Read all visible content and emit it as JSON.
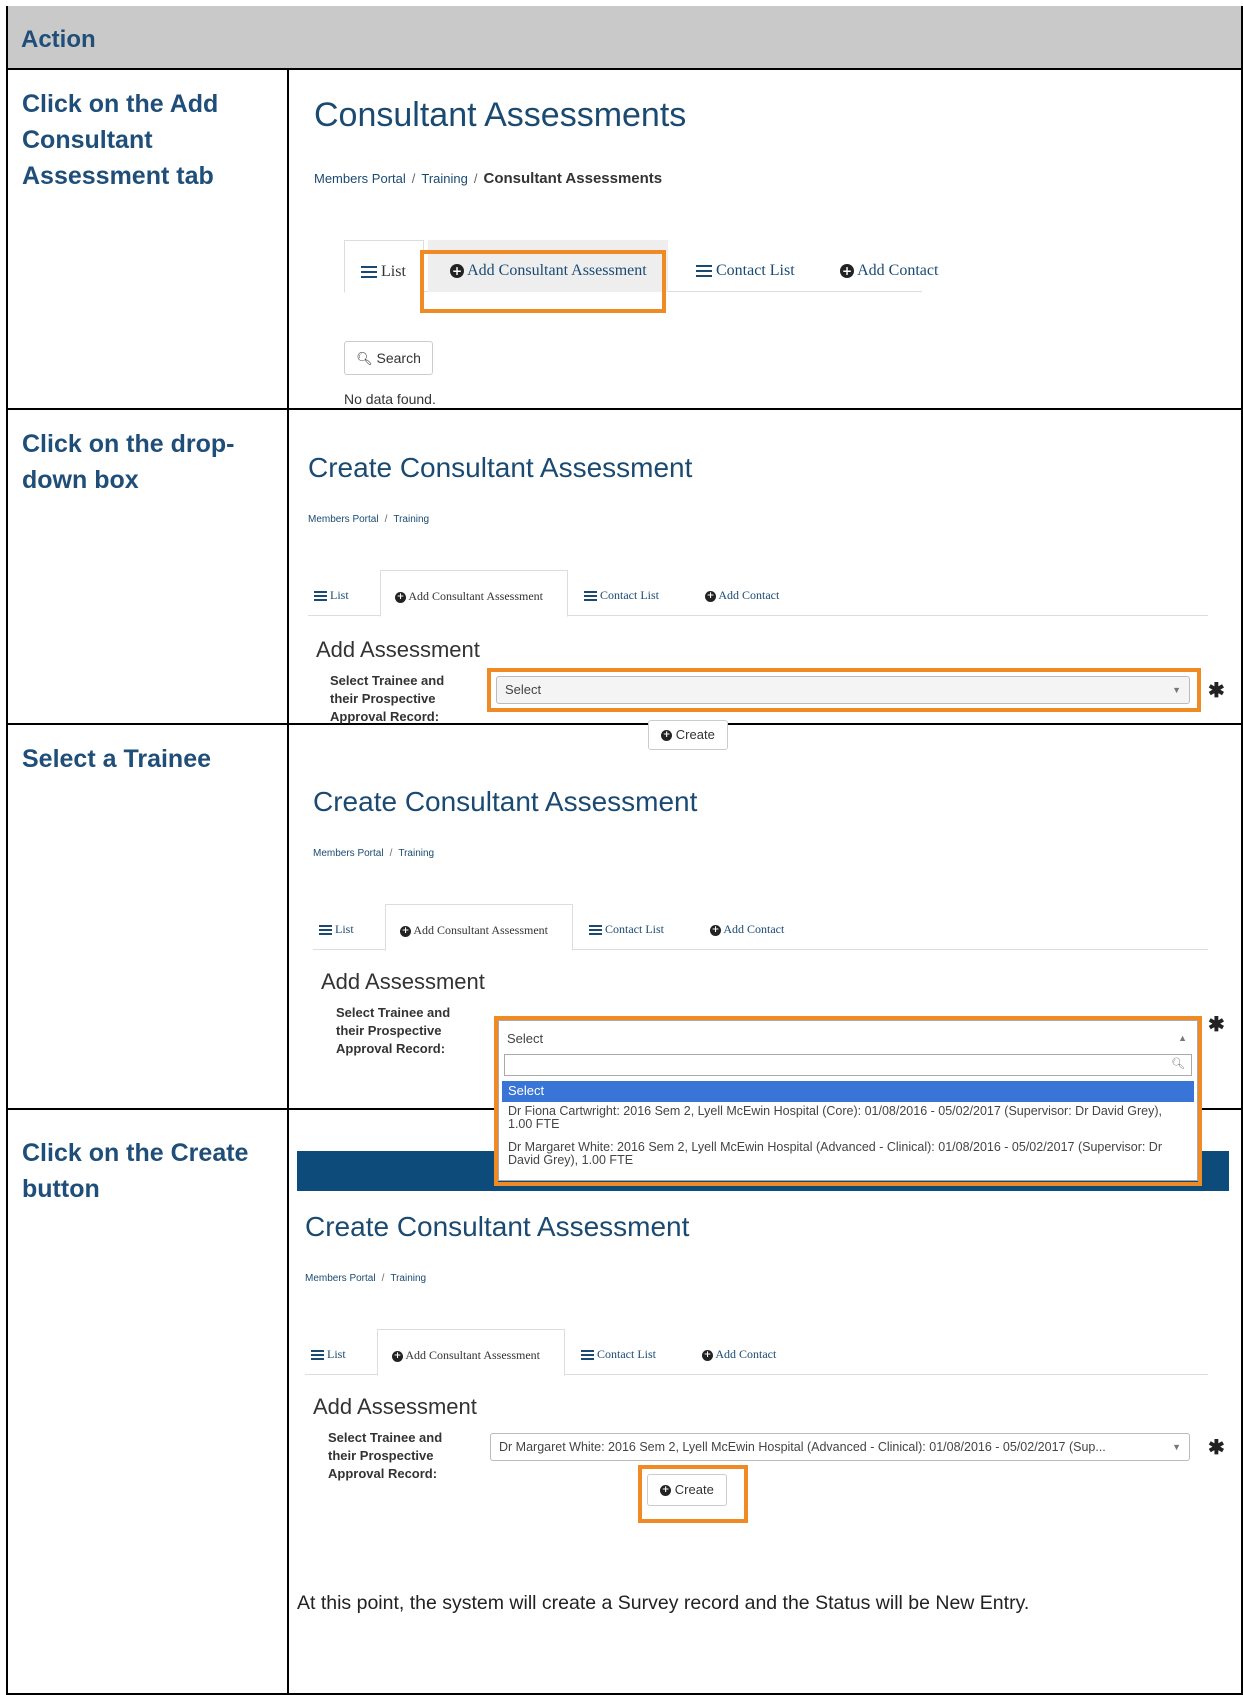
{
  "header": {
    "title": "Action"
  },
  "steps": [
    {
      "label": "Click on the Add Consultant Assessment tab"
    },
    {
      "label": "Click on the drop-down box"
    },
    {
      "label": "Select a Trainee"
    },
    {
      "label": "Click on the Create button"
    }
  ],
  "shot1": {
    "title": "Consultant Assessments",
    "breadcrumb": [
      "Members Portal",
      "Training",
      "Consultant Assessments"
    ],
    "tabs": [
      "List",
      "Add Consultant Assessment",
      "Contact List",
      "Add Contact"
    ],
    "search_label": "Search",
    "empty_text": "No data found."
  },
  "shot2": {
    "title": "Create Consultant Assessment",
    "breadcrumb": [
      "Members Portal",
      "Training"
    ],
    "tabs": [
      "List",
      "Add Consultant Assessment",
      "Contact List",
      "Add Contact"
    ],
    "subhead": "Add Assessment",
    "field_label": "Select Trainee and their Prospective Approval Record:",
    "select_value": "Select",
    "required": "✱",
    "create_label": "Create"
  },
  "shot3": {
    "title": "Create Consultant Assessment",
    "breadcrumb": [
      "Members Portal",
      "Training"
    ],
    "tabs": [
      "List",
      "Add Consultant Assessment",
      "Contact List",
      "Add Contact"
    ],
    "subhead": "Add Assessment",
    "field_label": "Select Trainee and their Prospective Approval Record:",
    "select_value": "Select",
    "required": "✱",
    "options": [
      "Select",
      "Dr Fiona Cartwright: 2016 Sem 2, Lyell McEwin Hospital (Core): 01/08/2016 - 05/02/2017 (Supervisor: Dr David Grey), 1.00 FTE",
      "Dr Margaret White: 2016 Sem 2, Lyell McEwin Hospital (Advanced - Clinical): 01/08/2016 - 05/02/2017 (Supervisor: Dr David Grey), 1.00 FTE"
    ]
  },
  "shot4": {
    "title": "Create Consultant Assessment",
    "breadcrumb": [
      "Members Portal",
      "Training"
    ],
    "tabs": [
      "List",
      "Add Consultant Assessment",
      "Contact List",
      "Add Contact"
    ],
    "subhead": "Add Assessment",
    "field_label": "Select Trainee and their Prospective Approval Record:",
    "select_value": "Dr Margaret White: 2016 Sem 2, Lyell McEwin Hospital (Advanced - Clinical): 01/08/2016 - 05/02/2017 (Sup...",
    "required": "✱",
    "create_label": "Create",
    "note": "At this point, the system will create a Survey record and the Status will be New Entry."
  }
}
